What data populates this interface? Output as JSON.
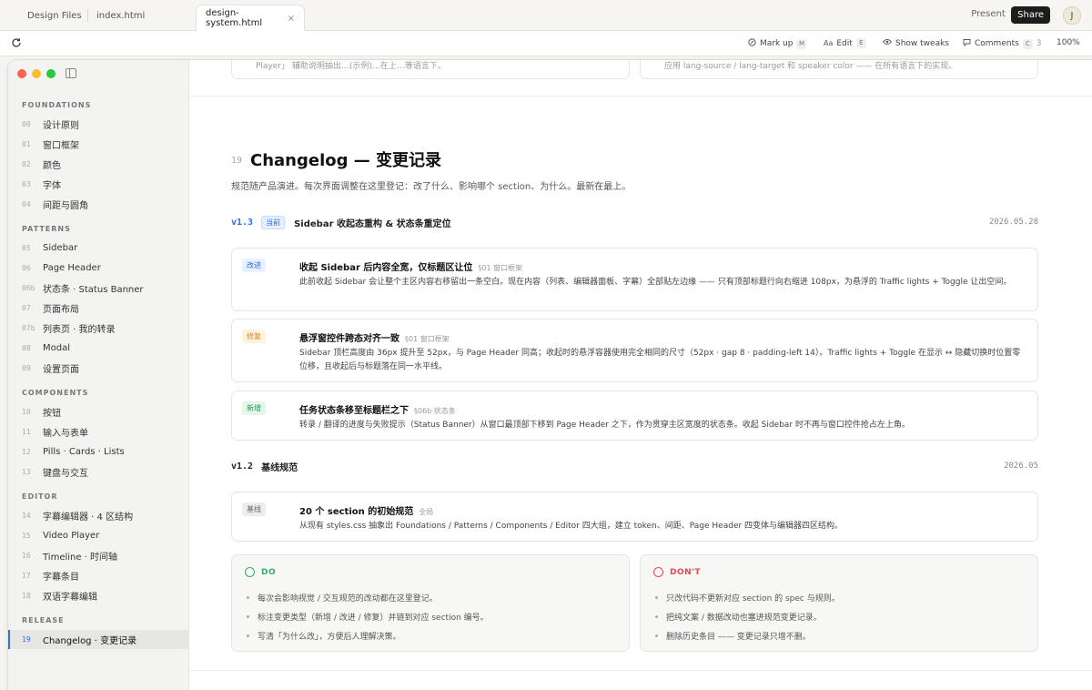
{
  "browser": {
    "tabs": [
      "Design Files",
      "index.html",
      "design-system.html"
    ],
    "close_glyph": "×",
    "present_label": "Present",
    "share_label": "Share",
    "avatar_initial": "J"
  },
  "toolbar": {
    "markup": {
      "label": "Mark up",
      "key": "M"
    },
    "edit": {
      "label": "Edit",
      "key": "E"
    },
    "tweaks": {
      "label": "Show tweaks"
    },
    "comments": {
      "label": "Comments",
      "key": "C",
      "count": "3"
    },
    "zoom": "100%"
  },
  "sidebar": {
    "groups": [
      {
        "title": "FOUNDATIONS",
        "items": [
          {
            "num": "00",
            "label": "设计原则"
          },
          {
            "num": "01",
            "label": "窗口框架"
          },
          {
            "num": "02",
            "label": "颜色"
          },
          {
            "num": "03",
            "label": "字体"
          },
          {
            "num": "04",
            "label": "间距与圆角"
          }
        ]
      },
      {
        "title": "PATTERNS",
        "items": [
          {
            "num": "05",
            "label": "Sidebar"
          },
          {
            "num": "06",
            "label": "Page Header"
          },
          {
            "num": "06b",
            "label": "状态条 · Status Banner"
          },
          {
            "num": "07",
            "label": "页面布局"
          },
          {
            "num": "07b",
            "label": "列表页 · 我的转录"
          },
          {
            "num": "08",
            "label": "Modal"
          },
          {
            "num": "09",
            "label": "设置页面"
          }
        ]
      },
      {
        "title": "COMPONENTS",
        "items": [
          {
            "num": "10",
            "label": "按钮"
          },
          {
            "num": "11",
            "label": "输入与表单"
          },
          {
            "num": "12",
            "label": "Pills · Cards · Lists"
          },
          {
            "num": "13",
            "label": "键盘与交互"
          }
        ]
      },
      {
        "title": "EDITOR",
        "items": [
          {
            "num": "14",
            "label": "字幕编辑器 · 4 区结构"
          },
          {
            "num": "15",
            "label": "Video Player"
          },
          {
            "num": "16",
            "label": "Timeline · 时间轴"
          },
          {
            "num": "17",
            "label": "字幕条目"
          },
          {
            "num": "18",
            "label": "双语字幕编辑"
          }
        ]
      },
      {
        "title": "RELEASE",
        "items": [
          {
            "num": "19",
            "label": "Changelog · 变更记录",
            "active": true
          }
        ]
      }
    ]
  },
  "prev_cards": [
    "Player」 辅助说明抽出…(示例)…在上…等语言下。",
    "应用 lang-source / lang-target 和 speaker color —— 在所有语言下的实现。"
  ],
  "section": {
    "num": "19",
    "title": "Changelog — 变更记录",
    "desc": "规范随产品演进。每次界面调整在这里登记：改了什么、影响哪个 section、为什么。最新在最上。"
  },
  "versions": [
    {
      "ver": "v1.3",
      "badge": "当前",
      "title": "Sidebar 收起态重构 & 状态条重定位",
      "date": "2026.05.28",
      "entries": [
        {
          "tag": "改进",
          "kind": "improve",
          "title": "收起 Sidebar 后内容全宽，仅标题区让位",
          "ref": "§01 窗口框架",
          "body": "此前收起 Sidebar 会让整个主区内容右移留出一条空白。现在内容（列表、编辑器面板、字幕）全部贴左边缘 —— 只有顶部标题行向右缩进 108px，为悬浮的 Traffic lights + Toggle 让出空间。"
        },
        {
          "tag": "修复",
          "kind": "fix",
          "title": "悬浮窗控件跨态对齐一致",
          "ref": "§01 窗口框架",
          "body": "Sidebar 顶栏高度由 36px 提升至 52px，与 Page Header 同高；收起时的悬浮容器使用完全相同的尺寸（52px · gap 8 · padding-left 14）。Traffic lights + Toggle 在显示 ↔ 隐藏切换时位置零位移，且收起后与标题落在同一水平线。"
        },
        {
          "tag": "新增",
          "kind": "new",
          "title": "任务状态条移至标题栏之下",
          "ref": "§06b 状态条",
          "body": "转录 / 翻译的进度与失败提示（Status Banner）从窗口最顶部下移到 Page Header 之下，作为贯穿主区宽度的状态条。收起 Sidebar 时不再与窗口控件抢占左上角。"
        }
      ]
    },
    {
      "ver": "v1.2",
      "badge": "",
      "title": "基线规范",
      "date": "2026.05",
      "entries": [
        {
          "tag": "基线",
          "kind": "base",
          "title": "20 个 section 的初始规范",
          "ref": "全局",
          "body": "从现有 styles.css 抽象出 Foundations / Patterns / Components / Editor 四大组，建立 token、间距、Page Header 四变体与编辑器四区结构。"
        }
      ]
    }
  ],
  "do": {
    "label": "DO",
    "color": "#2fb064",
    "items": [
      "每次会影响视觉 / 交互规范的改动都在这里登记。",
      "标注变更类型（新增 / 改进 / 修复）并链到对应 section 编号。",
      "写清「为什么改」，方便后人理解决策。"
    ]
  },
  "dont": {
    "label": "DON'T",
    "color": "#e5484d",
    "items": [
      "只改代码不更新对应 section 的 spec 与规则。",
      "把纯文案 / 数据改动也塞进规范变更记录。",
      "删除历史条目 —— 变更记录只增不删。"
    ]
  },
  "colors": {
    "accent": "#2f6fe4",
    "traffic_red": "#fe5f57",
    "traffic_yellow": "#febc2e",
    "traffic_green": "#28c840"
  }
}
